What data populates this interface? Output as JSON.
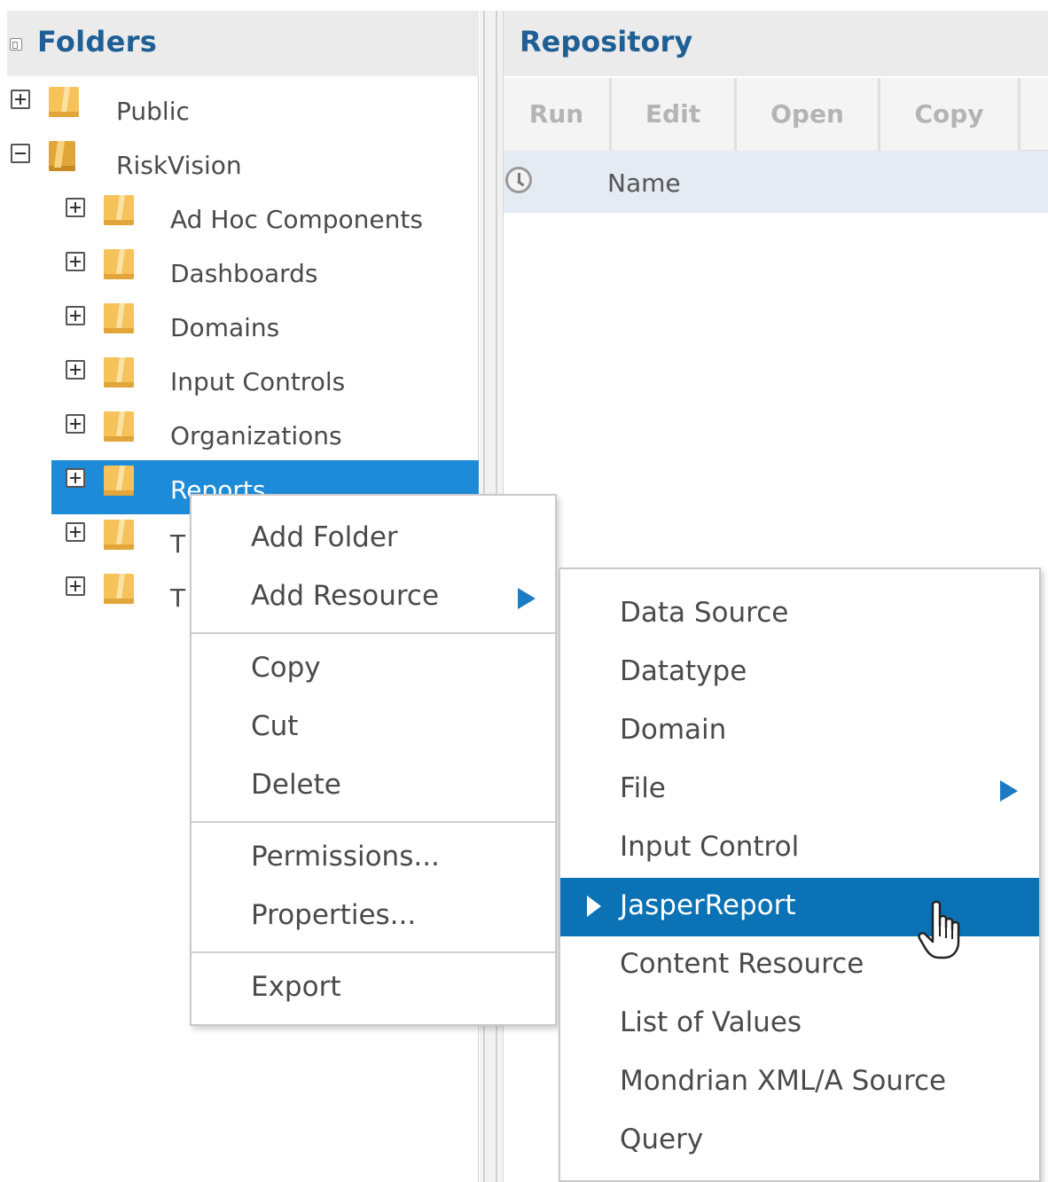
{
  "folders": {
    "title": "Folders",
    "tree": [
      {
        "label": "Public",
        "expander": "plus",
        "level": 0
      },
      {
        "label": "RiskVision",
        "expander": "minus",
        "level": 0
      },
      {
        "label": "Ad Hoc Components",
        "expander": "plus",
        "level": 1
      },
      {
        "label": "Dashboards",
        "expander": "plus",
        "level": 1
      },
      {
        "label": "Domains",
        "expander": "plus",
        "level": 1
      },
      {
        "label": "Input Controls",
        "expander": "plus",
        "level": 1
      },
      {
        "label": "Organizations",
        "expander": "plus",
        "level": 1
      },
      {
        "label": "Reports",
        "expander": "plus",
        "level": 1,
        "selected": true
      },
      {
        "label": "T",
        "expander": "plus",
        "level": 1
      },
      {
        "label": "T",
        "expander": "plus",
        "level": 1
      }
    ]
  },
  "repository": {
    "title": "Repository",
    "toolbar": {
      "run": "Run",
      "edit": "Edit",
      "open": "Open",
      "copy": "Copy"
    },
    "columns": {
      "name": "Name"
    }
  },
  "context_menu": {
    "add_folder": "Add Folder",
    "add_resource": "Add Resource",
    "copy": "Copy",
    "cut": "Cut",
    "delete": "Delete",
    "permissions": "Permissions...",
    "properties": "Properties...",
    "export": "Export"
  },
  "submenu": {
    "items": [
      {
        "label": "Data Source"
      },
      {
        "label": "Datatype"
      },
      {
        "label": "Domain"
      },
      {
        "label": "File",
        "has_submenu": true
      },
      {
        "label": "Input Control"
      },
      {
        "label": "JasperReport",
        "highlighted": true
      },
      {
        "label": "Content Resource"
      },
      {
        "label": "List of Values"
      },
      {
        "label": "Mondrian XML/A Source"
      },
      {
        "label": "Query"
      }
    ]
  },
  "colors": {
    "header_title": "#1f5f95",
    "selected_row": "#1e8bd8",
    "highlighted_menu_item": "#0b72b5",
    "submenu_arrow": "#1c7bc4"
  }
}
